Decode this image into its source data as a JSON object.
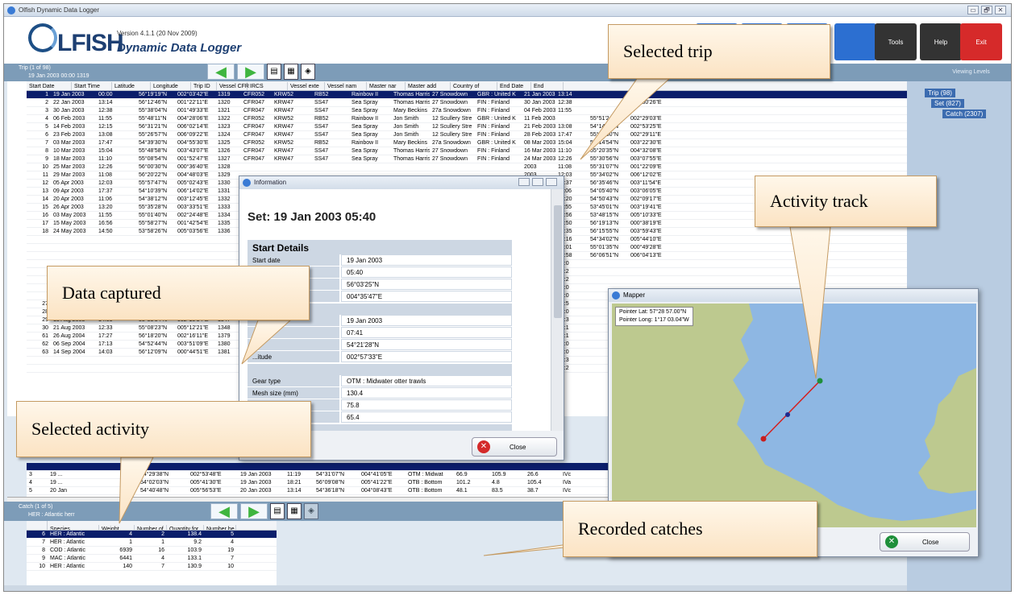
{
  "window": {
    "title": "Olfish Dynamic Data Logger",
    "controls": [
      "▭",
      "🗗",
      "✕"
    ]
  },
  "header": {
    "logo_text": "LFISH",
    "version": "Version 4.1.1 (20 Nov 2009)",
    "app_name": "Dynamic Data Logger",
    "buttons": [
      {
        "label": "",
        "color": "#2c6fd1"
      },
      {
        "label": "",
        "color": "#2c6fd1"
      },
      {
        "label": "Options",
        "color": "#2c6fd1"
      },
      {
        "label": "",
        "color": "#2c6fd1"
      },
      {
        "label": "Tools",
        "color": "#333333"
      },
      {
        "label": "Help",
        "color": "#333333"
      },
      {
        "label": "Exit",
        "color": "#d62a2a"
      }
    ]
  },
  "trip_bar": {
    "line1": "Trip (1 of 98)",
    "line2": "19 Jan 2003 00:00 1319"
  },
  "viewing_levels": {
    "title": "Viewing Levels",
    "tree": [
      "Trip (98)",
      "Set (827)",
      "Catch (2307)"
    ]
  },
  "trip_grid": {
    "columns": [
      "Start Date",
      "Start Time",
      "Latitude",
      "Longitude",
      "Trip ID",
      "Vessel CFR",
      "IRCS",
      "Vessel exte",
      "Vessel nam",
      "Master nar",
      "Master add",
      "Country of",
      "End Date",
      "End"
    ],
    "rows": [
      [
        "1",
        "19 Jan 2003",
        "00:00",
        "56°19'19\"N",
        "002°03'42\"E",
        "1319",
        "CFR052",
        "KRW52",
        "RB52",
        "Rainbow II",
        "Thomas Harris",
        "27 Snowdown",
        "GBR : United K",
        "21 Jan 2003",
        "13:14",
        "",
        ""
      ],
      [
        "2",
        "22 Jan 2003",
        "13:14",
        "56°12'46\"N",
        "001°22'11\"E",
        "1320",
        "CFR047",
        "KRW47",
        "SS47",
        "Sea Spray",
        "Thomas Harris",
        "27 Snowdown",
        "FIN : Finland",
        "30 Jan 2003",
        "12:38",
        "",
        "002°30'26\"E"
      ],
      [
        "3",
        "30 Jan 2003",
        "12:38",
        "55°38'04\"N",
        "001°49'33\"E",
        "1321",
        "CFR047",
        "KRW47",
        "SS47",
        "Sea Spray",
        "Mary Beckins",
        "27a Snowdown",
        "FIN : Finland",
        "04 Feb 2003",
        "11:55",
        "",
        ""
      ],
      [
        "4",
        "06 Feb 2003",
        "11:55",
        "55°48'11\"N",
        "004°28'06\"E",
        "1322",
        "CFR052",
        "KRW52",
        "RB52",
        "Rainbow II",
        "Jon Smith",
        "12 Scullery Stre",
        "GBR : United K",
        "11 Feb 2003",
        "",
        "55°51'24\"N",
        "002°29'03\"E"
      ],
      [
        "5",
        "14 Feb 2003",
        "12:15",
        "56°31'21\"N",
        "006°02'14\"E",
        "1323",
        "CFR047",
        "KRW47",
        "SS47",
        "Sea Spray",
        "Jon Smith",
        "12 Scullery Stre",
        "FIN : Finland",
        "21 Feb 2003",
        "13:08",
        "54°14'55\"N",
        "002°53'25\"E"
      ],
      [
        "6",
        "23 Feb 2003",
        "13:08",
        "55°26'57\"N",
        "006°09'22\"E",
        "1324",
        "CFR047",
        "KRW47",
        "SS47",
        "Sea Spray",
        "Jon Smith",
        "12 Scullery Stre",
        "FIN : Finland",
        "28 Feb 2003",
        "17:47",
        "55°54'00\"N",
        "002°29'11\"E"
      ],
      [
        "7",
        "03 Mar 2003",
        "17:47",
        "54°39'30\"N",
        "004°55'30\"E",
        "1325",
        "CFR052",
        "KRW52",
        "RB52",
        "Rainbow II",
        "Mary Beckins",
        "27a Snowdown",
        "GBR : United K",
        "08 Mar 2003",
        "15:04",
        "56°14'54\"N",
        "003°22'30\"E"
      ],
      [
        "8",
        "10 Mar 2003",
        "15:04",
        "55°48'58\"N",
        "003°43'07\"E",
        "1326",
        "CFR047",
        "KRW47",
        "SS47",
        "Sea Spray",
        "Thomas Harris",
        "27 Snowdown",
        "FIN : Finland",
        "16 Mar 2003",
        "11:10",
        "55°20'35\"N",
        "004°32'08\"E"
      ],
      [
        "9",
        "18 Mar 2003",
        "11:10",
        "55°08'54\"N",
        "001°52'47\"E",
        "1327",
        "CFR047",
        "KRW47",
        "SS47",
        "Sea Spray",
        "Thomas Harris",
        "27 Snowdown",
        "FIN : Finland",
        "24 Mar 2003",
        "12:26",
        "55°30'56\"N",
        "003°07'55\"E"
      ],
      [
        "10",
        "25 Mar 2003",
        "12:26",
        "56°00'30\"N",
        "000°36'40\"E",
        "1328",
        "",
        "",
        "",
        "",
        "",
        "",
        "",
        "2003",
        "11:08",
        "55°31'07\"N",
        "001°22'09\"E"
      ],
      [
        "11",
        "29 Mar 2003",
        "11:08",
        "56°20'22\"N",
        "004°48'03\"E",
        "1329",
        "",
        "",
        "",
        "",
        "",
        "",
        "",
        "2003",
        "12:03",
        "55°34'02\"N",
        "006°12'02\"E"
      ],
      [
        "12",
        "05 Apr 2003",
        "12:03",
        "55°57'47\"N",
        "005°02'43\"E",
        "1330",
        "",
        "",
        "",
        "",
        "",
        "",
        "",
        "2003",
        "17:37",
        "56°35'46\"N",
        "003°11'54\"E"
      ],
      [
        "13",
        "09 Apr 2003",
        "17:37",
        "54°10'39\"N",
        "006°14'02\"E",
        "1331",
        "",
        "",
        "",
        "",
        "",
        "",
        "",
        "2003",
        "11:06",
        "54°05'40\"N",
        "003°06'05\"E"
      ],
      [
        "14",
        "20 Apr 2003",
        "11:06",
        "54°38'12\"N",
        "003°12'45\"E",
        "1332",
        "",
        "",
        "",
        "",
        "",
        "",
        "",
        "2003",
        "13:20",
        "54°50'43\"N",
        "002°09'17\"E"
      ],
      [
        "15",
        "26 Apr 2003",
        "13:20",
        "55°35'28\"N",
        "003°33'51\"E",
        "1333",
        "",
        "",
        "",
        "",
        "",
        "",
        "",
        "2003",
        "11:55",
        "53°45'01\"N",
        "003°19'41\"E"
      ],
      [
        "16",
        "03 May 2003",
        "11:55",
        "55°01'40\"N",
        "002°24'48\"E",
        "1334",
        "",
        "",
        "",
        "",
        "",
        "",
        "",
        "2003",
        "16:56",
        "53°48'15\"N",
        "005°10'33\"E"
      ],
      [
        "17",
        "15 May 2003",
        "16:56",
        "55°58'27\"N",
        "001°42'54\"E",
        "1335",
        "",
        "",
        "",
        "",
        "",
        "",
        "",
        "2003",
        "14:50",
        "56°19'13\"N",
        "000°38'19\"E"
      ],
      [
        "18",
        "24 May 2003",
        "14:50",
        "53°58'26\"N",
        "005°03'56\"E",
        "1336",
        "",
        "",
        "",
        "",
        "",
        "",
        "",
        "2003",
        "15:35",
        "56°15'55\"N",
        "003°59'43\"E"
      ],
      [
        "",
        "",
        "",
        "",
        "",
        "",
        "",
        "",
        "",
        "",
        "",
        "",
        "",
        "2003",
        "18:16",
        "54°34'02\"N",
        "005°44'10\"E"
      ],
      [
        "",
        "",
        "",
        "",
        "",
        "",
        "",
        "",
        "",
        "",
        "",
        "",
        "",
        "2003",
        "13:01",
        "55°01'35\"N",
        "000°49'28\"E"
      ],
      [
        "",
        "",
        "",
        "",
        "",
        "",
        "",
        "",
        "",
        "",
        "",
        "",
        "",
        "2003",
        "10:58",
        "56°06'51\"N",
        "006°04'13\"E"
      ],
      [
        "",
        "",
        "",
        "",
        "",
        "",
        "",
        "",
        "",
        "",
        "",
        "",
        "",
        "2003",
        "15:0",
        "",
        ""
      ],
      [
        "",
        "",
        "",
        "",
        "",
        "",
        "",
        "",
        "",
        "",
        "",
        "",
        "",
        "2003",
        "10:2",
        "",
        ""
      ],
      [
        "",
        "",
        "",
        "",
        "",
        "",
        "",
        "",
        "",
        "",
        "",
        "",
        "",
        "2003",
        "16:2",
        "",
        ""
      ],
      [
        "",
        "",
        "",
        "",
        "",
        "",
        "",
        "",
        "",
        "",
        "",
        "",
        "",
        "2003",
        "13:0",
        "",
        ""
      ],
      [
        "",
        "",
        "",
        "",
        "",
        "",
        "",
        "",
        "",
        "",
        "",
        "",
        "",
        "2003",
        "17:0",
        "",
        ""
      ],
      [
        "27",
        "28 Jul 2003",
        "17:00",
        "54°32'08\"N",
        "",
        "",
        "",
        "",
        "",
        "",
        "",
        "",
        "",
        "2003",
        "17:5",
        "",
        ""
      ],
      [
        "28",
        "04 Aug 2003",
        "17:57",
        "54°53'15\"N",
        "001°52'19\"E",
        "1348",
        "",
        "",
        "",
        "",
        "",
        "",
        "",
        "2003",
        "14:0",
        "",
        ""
      ],
      [
        "29",
        "13 Aug 2003",
        "14:03",
        "53°53'54\"N",
        "002°15'34\"E",
        "1347",
        "",
        "",
        "",
        "",
        "",
        "",
        "",
        "2003",
        "12:3",
        "",
        ""
      ],
      [
        "30",
        "21 Aug 2003",
        "12:33",
        "55°08'23\"N",
        "005°12'21\"E",
        "1348",
        "",
        "",
        "",
        "",
        "",
        "",
        "",
        "2003",
        "12:1",
        "",
        ""
      ],
      [
        "61",
        "26 Aug 2004",
        "17:27",
        "56°18'20\"N",
        "002°16'11\"E",
        "1379",
        "",
        "",
        "",
        "",
        "",
        "",
        "",
        "2004",
        "17:1",
        "",
        ""
      ],
      [
        "62",
        "06 Sep 2004",
        "17:13",
        "54°52'44\"N",
        "003°51'09\"E",
        "1380",
        "",
        "",
        "",
        "",
        "",
        "",
        "",
        "2004",
        "14:0",
        "",
        ""
      ],
      [
        "63",
        "14 Sep 2004",
        "14:03",
        "56°12'09\"N",
        "000°44'51\"E",
        "1381",
        "",
        "",
        "",
        "",
        "",
        "",
        "",
        "2004",
        "16:0",
        "",
        ""
      ],
      [
        "",
        "",
        "",
        "",
        "",
        "",
        "",
        "",
        "",
        "",
        "",
        "",
        "",
        "2004",
        "12:3",
        "",
        ""
      ],
      [
        "",
        "",
        "",
        "",
        "",
        "",
        "",
        "",
        "",
        "",
        "",
        "",
        "",
        "2004",
        "12:2",
        "",
        ""
      ]
    ]
  },
  "set_grid": {
    "right_headers": [
      "IO ar",
      "ICES"
    ],
    "rows": [
      [
        "3",
        "19 ...",
        "",
        "54°29'38\"N",
        "002°53'48\"E",
        "19 Jan 2003",
        "11:19",
        "54°31'07\"N",
        "004°41'05\"E",
        "OTM : Midwat",
        "66.9",
        "105.9",
        "26.6",
        "IVc"
      ],
      [
        "4",
        "19 ...",
        "",
        "54°02'03\"N",
        "005°41'30\"E",
        "19 Jan 2003",
        "18:21",
        "56°09'08\"N",
        "005°41'22\"E",
        "OTB : Bottom",
        "101.2",
        "4.8",
        "105.4",
        "IVa"
      ],
      [
        "5",
        "20 Jan",
        "",
        "54°40'48\"N",
        "005°56'53\"E",
        "20 Jan 2003",
        "13:14",
        "54°36'18\"N",
        "004°08'43\"E",
        "OTB : Bottom",
        "48.1",
        "83.5",
        "38.7",
        "IVc"
      ]
    ],
    "selected_right": [
      "",
      "IVc",
      "IVc"
    ]
  },
  "catch_bar": {
    "line1": "Catch (1 of 5)",
    "line2": "HER : Atlantic herr"
  },
  "catch_grid": {
    "columns": [
      "Species",
      "Weight",
      "Number of",
      "Quantity for",
      "Number he"
    ],
    "rows": [
      [
        "6",
        "HER : Atlantic",
        "4",
        "2",
        "138.4",
        "5"
      ],
      [
        "7",
        "HER : Atlantic",
        "1",
        "1",
        "9.2",
        "4"
      ],
      [
        "8",
        "COD : Atlantic",
        "6939",
        "16",
        "103.9",
        "19"
      ],
      [
        "9",
        "MAC : Atlantic",
        "6441",
        "4",
        "133.1",
        "7"
      ],
      [
        "10",
        "HER : Atlantic",
        "140",
        "7",
        "130.9",
        "10"
      ]
    ]
  },
  "info_dialog": {
    "title": "Information",
    "heading": "Set: 19 Jan 2003 05:40",
    "section1": "Start Details",
    "rows1": [
      {
        "k": "Start date",
        "v": "19 Jan 2003"
      },
      {
        "k": "Start time",
        "v": "05:40"
      },
      {
        "k": "",
        "v": "56°03'25\"N"
      },
      {
        "k": "",
        "v": "004°35'47\"E"
      }
    ],
    "rows2": [
      {
        "k": "",
        "v": "19 Jan 2003"
      },
      {
        "k": "",
        "v": "07:41"
      },
      {
        "k": "",
        "v": "54°21'28\"N"
      },
      {
        "k": "...itude",
        "v": "002°57'33\"E"
      }
    ],
    "rows3": [
      {
        "k": "Gear type",
        "v": "OTM : Midwater otter trawls"
      },
      {
        "k": "Mesh size (mm)",
        "v": "130.4"
      },
      {
        "k": "Depth deployed (m)",
        "v": "75.8"
      },
      {
        "k": "Length of net (m)",
        "v": "65.4"
      }
    ],
    "rows4": [
      {
        "k": "",
        "v": "IVc"
      }
    ],
    "close_label": "Close"
  },
  "mapper": {
    "title": "Mapper",
    "pointer_lat": "Pointer Lat: 57°28 57.00\"N",
    "pointer_long": "Pointer Long: 1°17 03.04\"W",
    "close_label": "Close",
    "colors": {
      "sea": "#8eb7e3",
      "land": "#bdc98f",
      "track": "#d42020",
      "start": "#1e8f3a",
      "end": "#c81e1e",
      "mid": "#1e2a8f"
    }
  },
  "callouts": {
    "selected_trip": "Selected trip",
    "activity_track": "Activity track",
    "data_captured": "Data captured",
    "selected_activity": "Selected activity",
    "recorded_catches": "Recorded catches"
  }
}
